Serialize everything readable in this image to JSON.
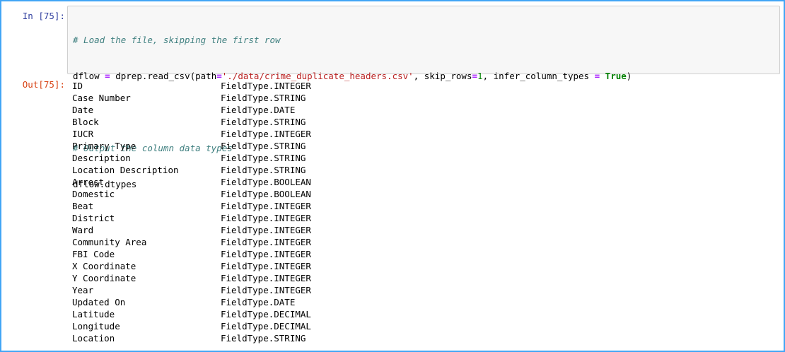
{
  "cell": {
    "in_prompt": "In [75]:",
    "out_prompt": "Out[75]:",
    "code": {
      "comment1": "# Load the file, skipping the first row",
      "line2_var": "dflow",
      "line2_eq": "=",
      "line2_call": "dprep.read_csv(path",
      "line2_eq2": "=",
      "line2_path": "'./data/crime_duplicate_headers.csv'",
      "line2_skip": ", skip_rows",
      "line2_eq3": "=",
      "line2_num": "1",
      "line2_infer": ", infer_column_types",
      "line2_eq4": "=",
      "line2_true": "True",
      "line2_close": ")",
      "comment2": "# Output the column data types",
      "line4": "dflow.dtypes"
    },
    "output_rows": [
      {
        "name": "ID",
        "type": "FieldType.INTEGER"
      },
      {
        "name": "Case Number",
        "type": "FieldType.STRING"
      },
      {
        "name": "Date",
        "type": "FieldType.DATE"
      },
      {
        "name": "Block",
        "type": "FieldType.STRING"
      },
      {
        "name": "IUCR",
        "type": "FieldType.INTEGER"
      },
      {
        "name": "Primary Type",
        "type": "FieldType.STRING"
      },
      {
        "name": "Description",
        "type": "FieldType.STRING"
      },
      {
        "name": "Location Description",
        "type": "FieldType.STRING"
      },
      {
        "name": "Arrest",
        "type": "FieldType.BOOLEAN"
      },
      {
        "name": "Domestic",
        "type": "FieldType.BOOLEAN"
      },
      {
        "name": "Beat",
        "type": "FieldType.INTEGER"
      },
      {
        "name": "District",
        "type": "FieldType.INTEGER"
      },
      {
        "name": "Ward",
        "type": "FieldType.INTEGER"
      },
      {
        "name": "Community Area",
        "type": "FieldType.INTEGER"
      },
      {
        "name": "FBI Code",
        "type": "FieldType.INTEGER"
      },
      {
        "name": "X Coordinate",
        "type": "FieldType.INTEGER"
      },
      {
        "name": "Y Coordinate",
        "type": "FieldType.INTEGER"
      },
      {
        "name": "Year",
        "type": "FieldType.INTEGER"
      },
      {
        "name": "Updated On",
        "type": "FieldType.DATE"
      },
      {
        "name": "Latitude",
        "type": "FieldType.DECIMAL"
      },
      {
        "name": "Longitude",
        "type": "FieldType.DECIMAL"
      },
      {
        "name": "Location",
        "type": "FieldType.STRING"
      }
    ]
  },
  "colors": {
    "selected_border": "#42a5f5",
    "in_prompt": "#303f9f",
    "out_prompt": "#d84315",
    "comment": "#408080",
    "string": "#ba2121",
    "operator": "#aa22ff",
    "number": "#008000",
    "keyword": "#008000"
  }
}
